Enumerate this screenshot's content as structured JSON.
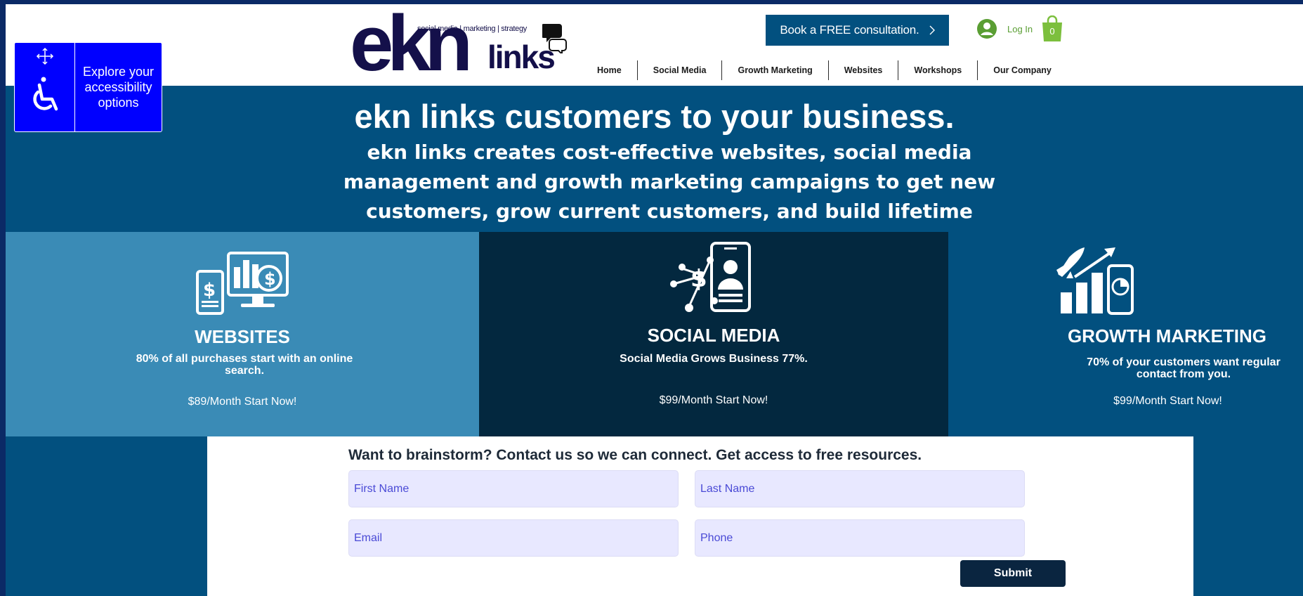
{
  "logo": {
    "big_text": "ekn",
    "small_text": "links",
    "tagline": "social media | marketing | strategy"
  },
  "header": {
    "cta_label": "Book a FREE consultation.",
    "login_label": "Log In",
    "cart_count": "0"
  },
  "nav": [
    "Home",
    "Social Media",
    "Growth Marketing",
    "Websites",
    "Workshops",
    "Our Company"
  ],
  "accessibility": {
    "label": "Explore your accessibility options"
  },
  "hero": {
    "title": "ekn links customers to your business.",
    "subtitle": "ekn links creates cost-effective websites, social media management and growth marketing campaigns to get new customers, grow current customers, and build lifetime value."
  },
  "services": [
    {
      "title": "WEBSITES",
      "description": "80% of all purchases start with an online search.",
      "price": "$89/Month Start Now!",
      "color": "#3a8bb6"
    },
    {
      "title": "SOCIAL MEDIA",
      "description": "Social Media Grows Business 77%.",
      "price": "$99/Month Start Now!",
      "color": "#03283f"
    },
    {
      "title": "GROWTH MARKETING",
      "description": "70% of your customers want regular contact from you.",
      "price": "$99/Month Start Now!",
      "color": "#02507f"
    }
  ],
  "form": {
    "heading": "Want to brainstorm? Contact us so we can connect. Get access to free resources.",
    "first_name_placeholder": "First Name",
    "last_name_placeholder": "Last Name",
    "email_placeholder": "Email",
    "phone_placeholder": "Phone",
    "submit_label": "Submit"
  },
  "colors": {
    "primary": "#02507f",
    "accent_green": "#5a9e33",
    "a11y_blue": "#0000ff",
    "dark_navy": "#03283f",
    "card_light_blue": "#3a8bb6"
  }
}
